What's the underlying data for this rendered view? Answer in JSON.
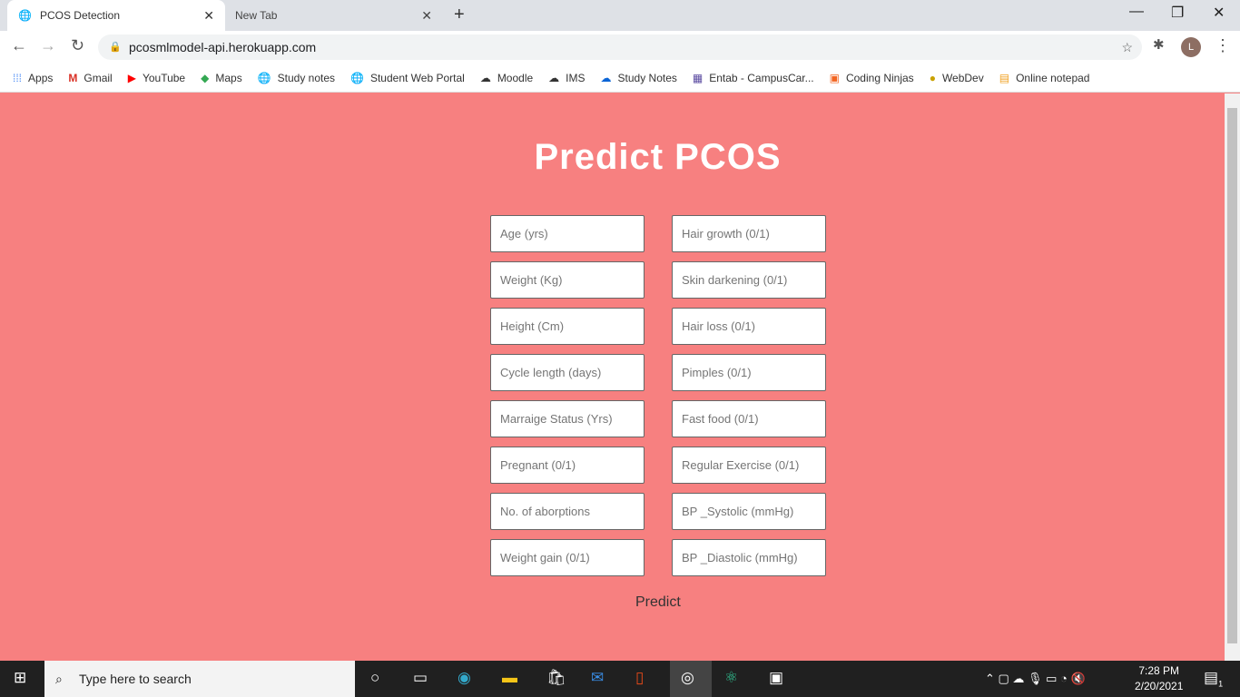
{
  "browser": {
    "tabs": [
      {
        "title": "PCOS Detection",
        "active": true
      },
      {
        "title": "New Tab",
        "active": false
      }
    ],
    "url": "pcosmlmodel-api.herokuapp.com",
    "profile_initial": "L",
    "bookmarks": [
      "Apps",
      "Gmail",
      "YouTube",
      "Maps",
      "Study notes",
      "Student Web Portal",
      "Moodle",
      "IMS",
      "Study Notes",
      "Entab - CampusCar...",
      "Coding Ninjas",
      "WebDev",
      "Online notepad"
    ]
  },
  "page": {
    "title": "Predict PCOS",
    "background": "#f78080",
    "left_fields": [
      "Age (yrs)",
      "Weight (Kg)",
      "Height (Cm)",
      "Cycle length (days)",
      "Marraige Status (Yrs)",
      "Pregnant (0/1)",
      "No. of aborptions",
      "Weight gain (0/1)"
    ],
    "right_fields": [
      "Hair growth (0/1)",
      "Skin darkening (0/1)",
      "Hair loss (0/1)",
      "Pimples (0/1)",
      "Fast food (0/1)",
      "Regular Exercise (0/1)",
      "BP _Systolic (mmHg)",
      "BP _Diastolic (mmHg)"
    ],
    "submit": "Predict"
  },
  "taskbar": {
    "search_placeholder": "Type here to search",
    "time": "7:28 PM",
    "date": "2/20/2021",
    "notifications": "1"
  }
}
